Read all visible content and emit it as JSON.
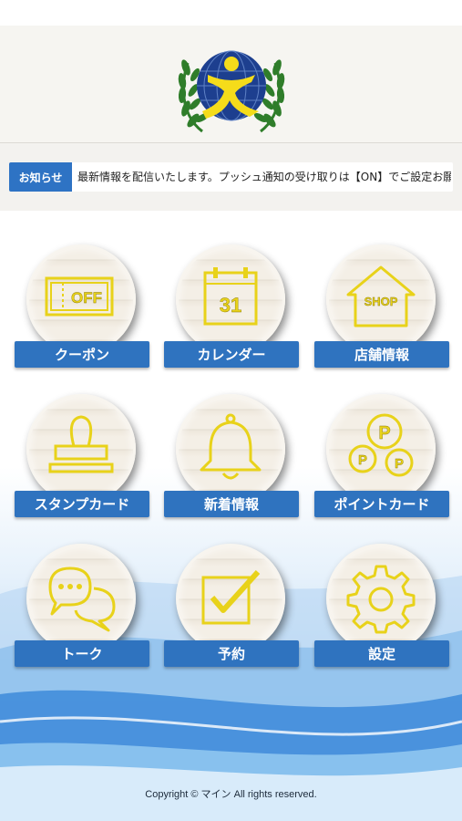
{
  "news": {
    "badge": "お知らせ",
    "text": "最新情報を配信いたします。プッシュ通知の受け取りは【ON】でご設定お願い"
  },
  "menu": [
    {
      "label": "クーポン",
      "icon": "coupon-icon"
    },
    {
      "label": "カレンダー",
      "icon": "calendar-icon"
    },
    {
      "label": "店舗情報",
      "icon": "shop-icon"
    },
    {
      "label": "スタンプカード",
      "icon": "stamp-icon"
    },
    {
      "label": "新着情報",
      "icon": "bell-icon"
    },
    {
      "label": "ポイントカード",
      "icon": "points-icon"
    },
    {
      "label": "トーク",
      "icon": "chat-icon"
    },
    {
      "label": "予約",
      "icon": "checkbox-icon"
    },
    {
      "label": "設定",
      "icon": "gear-icon"
    }
  ],
  "icon_text": {
    "coupon": "OFF",
    "calendar": "31",
    "shop": "SHOP",
    "point": "P"
  },
  "colors": {
    "accent": "#2f73bf",
    "icon_yellow": "#e8d21a"
  },
  "footer": "Copyright © マイン All rights reserved."
}
